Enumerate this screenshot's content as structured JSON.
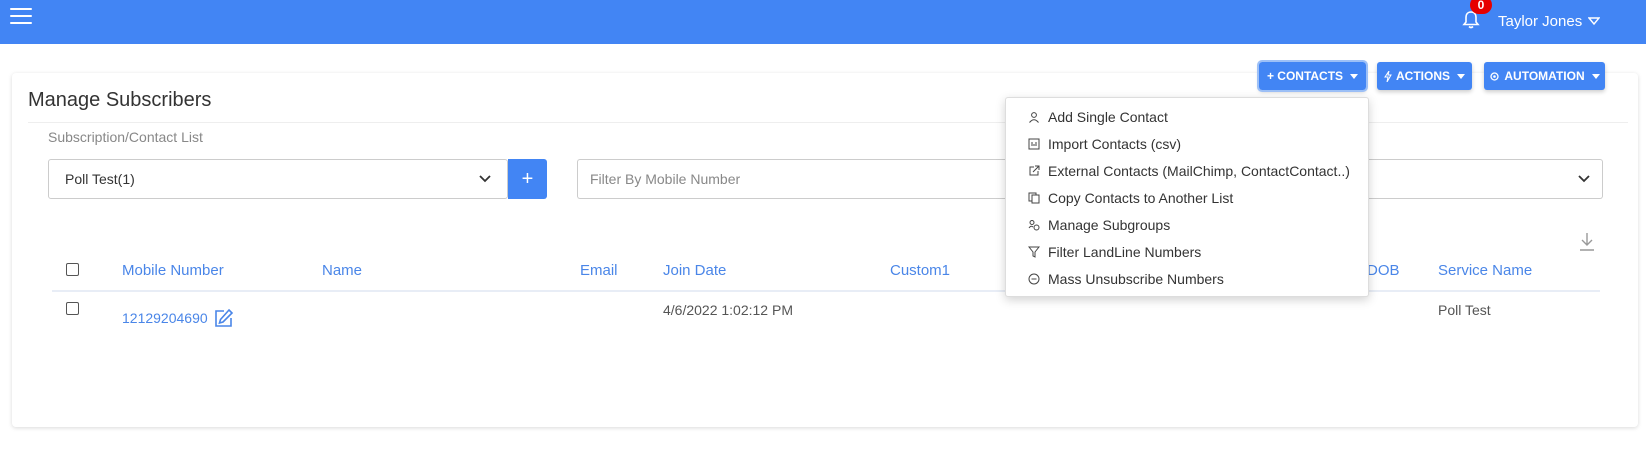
{
  "header": {
    "notification_count": "0",
    "user_name": "Taylor Jones"
  },
  "page": {
    "title": "Manage Subscribers"
  },
  "toolbar": {
    "contacts_label": "+ CONTACTS",
    "actions_label": "ACTIONS",
    "automation_label": "AUTOMATION"
  },
  "filters": {
    "list_label": "Subscription/Contact List",
    "list_selected": "Poll Test(1)",
    "add_label": "+",
    "mobile_placeholder": "Filter By Mobile Number"
  },
  "contacts_menu": {
    "items": [
      {
        "label": "Add Single Contact",
        "icon": "person-icon"
      },
      {
        "label": "Import Contacts (csv)",
        "icon": "csv-icon"
      },
      {
        "label": "External Contacts (MailChimp, ContactContact..)",
        "icon": "external-link-icon"
      },
      {
        "label": "Copy Contacts to Another List",
        "icon": "copy-icon"
      },
      {
        "label": "Manage Subgroups",
        "icon": "subgroups-icon"
      },
      {
        "label": "Filter LandLine Numbers",
        "icon": "filter-icon"
      },
      {
        "label": "Mass Unsubscribe Numbers",
        "icon": "minus-circle-icon"
      }
    ]
  },
  "table": {
    "columns": [
      "Mobile Number",
      "Name",
      "Email",
      "Join Date",
      "Custom1",
      "DOB",
      "Service Name"
    ],
    "rows": [
      {
        "mobile": "12129204690",
        "name": "",
        "email": "",
        "join_date": "4/6/2022 1:02:12 PM",
        "custom1": "",
        "dob": "",
        "service_name": "Poll Test"
      }
    ]
  },
  "colors": {
    "primary": "#4285f4",
    "badge": "#e60000",
    "link": "#4a86e8"
  }
}
